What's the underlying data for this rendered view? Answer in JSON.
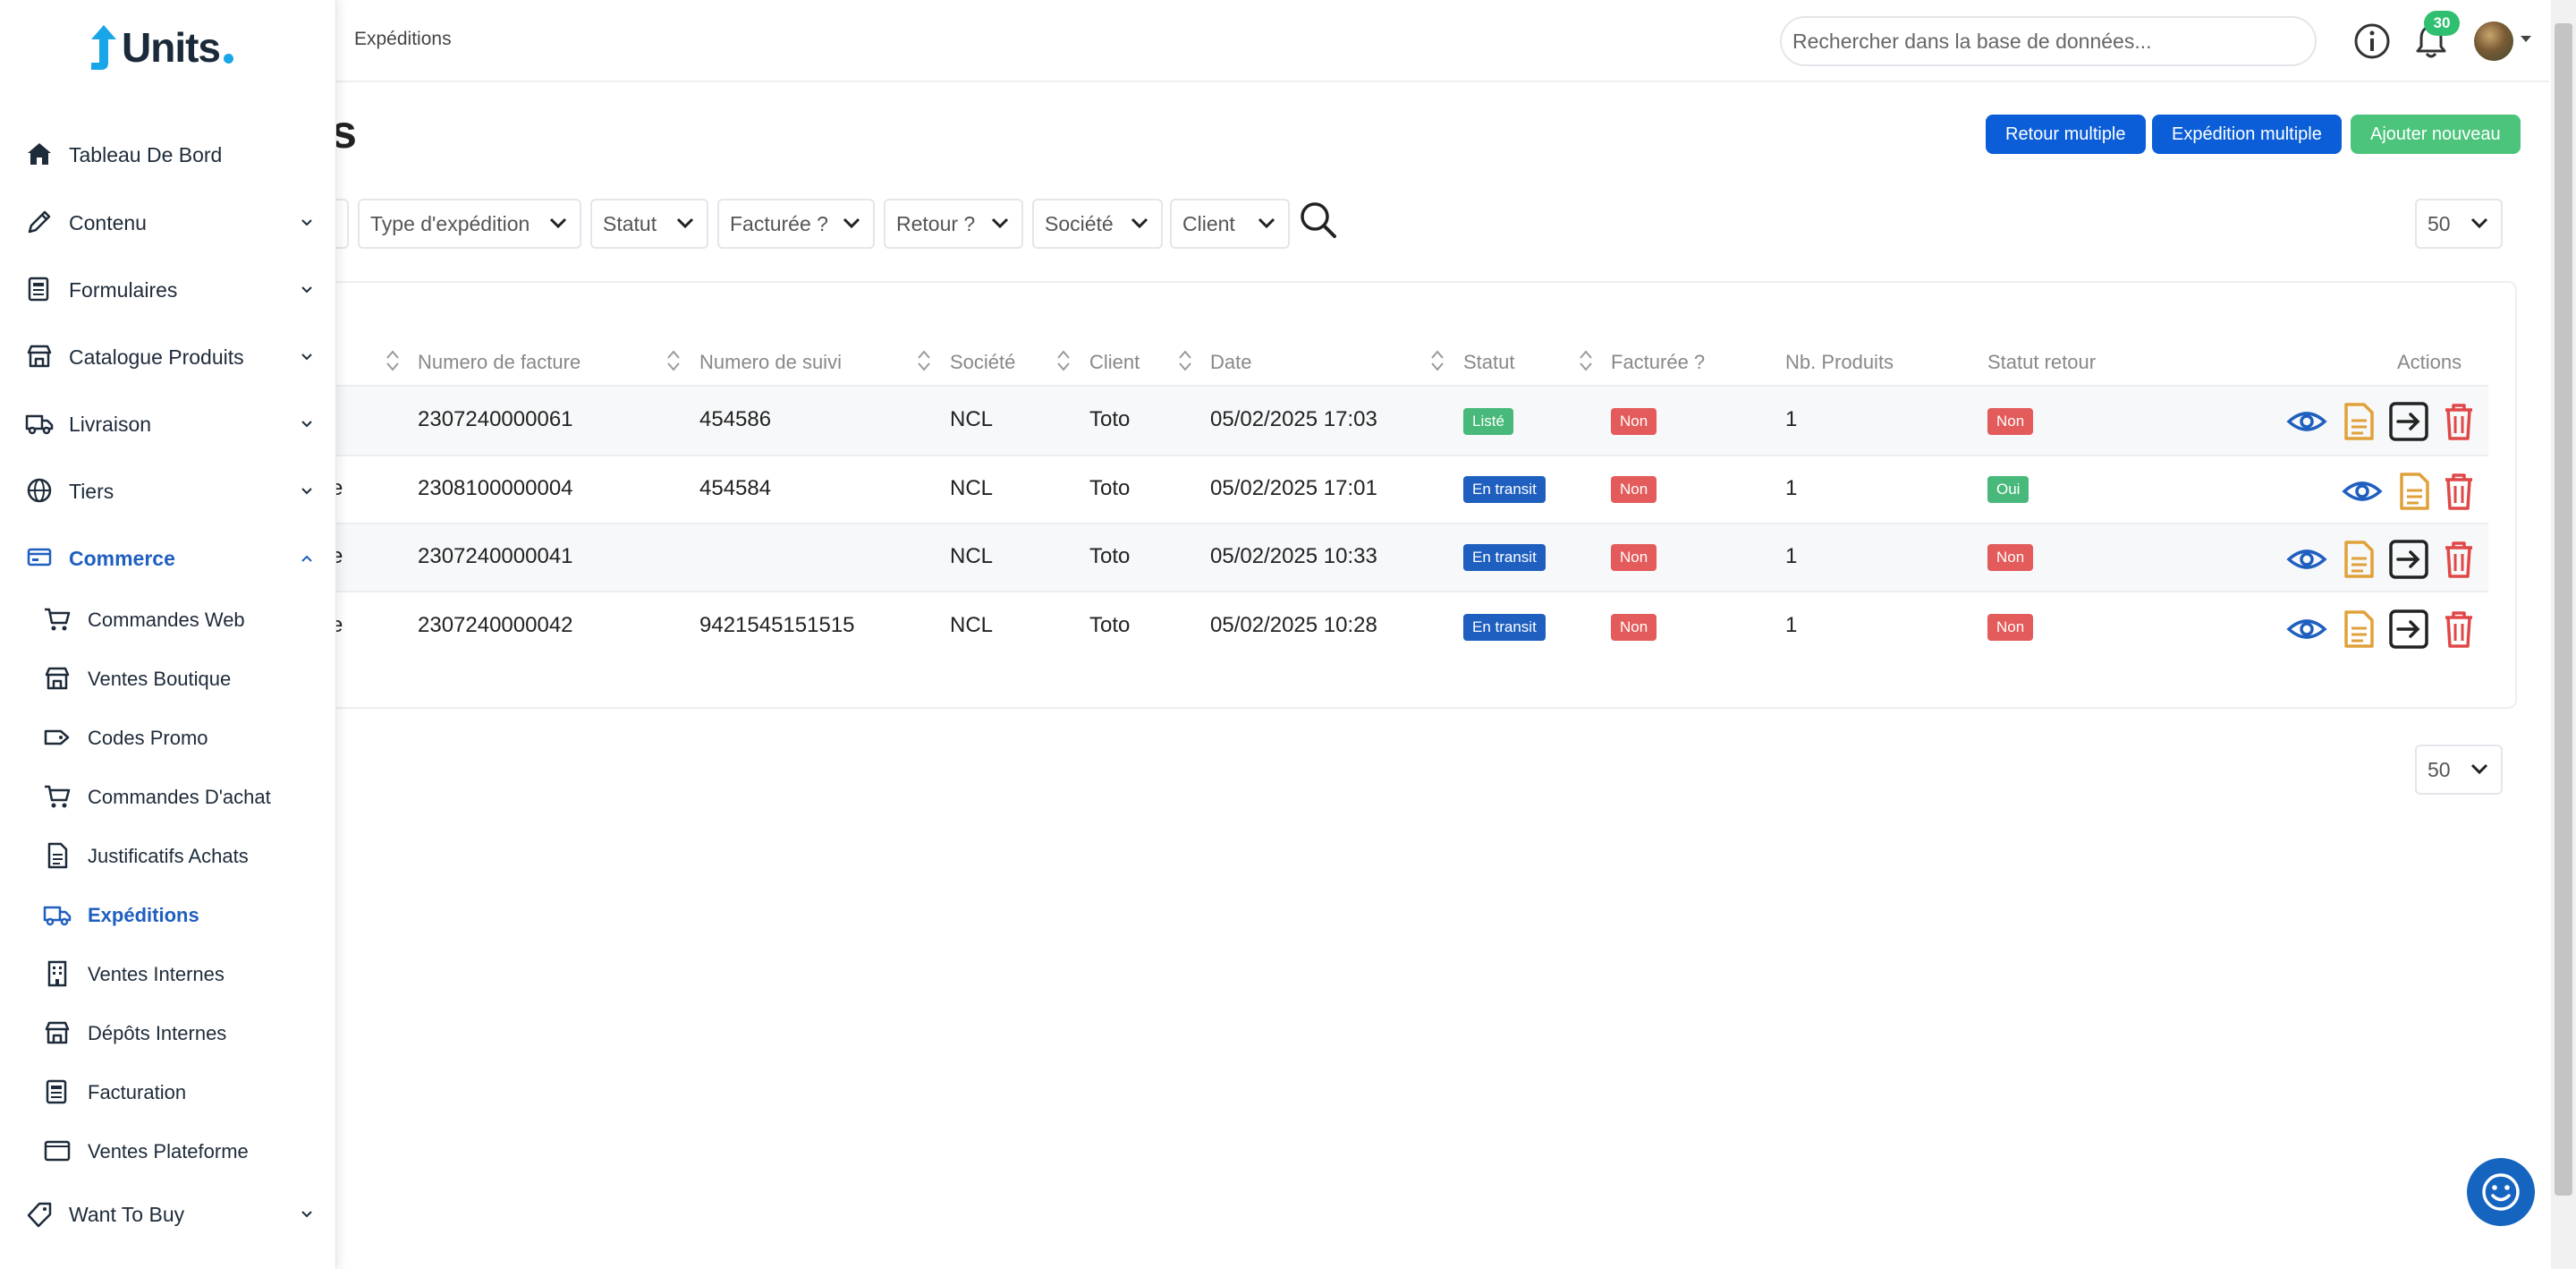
{
  "breadcrumb": {
    "current": "Expéditions"
  },
  "search": {
    "placeholder": "Rechercher dans la base de données..."
  },
  "notifications": {
    "count": "30"
  },
  "page": {
    "title_fragment": "s"
  },
  "actions": {
    "retour_multiple": "Retour multiple",
    "expedition_multiple": "Expédition multiple",
    "ajouter_nouveau": "Ajouter nouveau"
  },
  "filters": {
    "type_expedition": "Type d'expédition",
    "statut": "Statut",
    "facturee": "Facturée ?",
    "retour": "Retour ?",
    "societe": "Société",
    "client": "Client",
    "per_page_top": "50",
    "per_page_bottom": "50"
  },
  "table": {
    "headers": {
      "numero_facture": "Numero de facture",
      "numero_suivi": "Numero de suivi",
      "societe": "Société",
      "client": "Client",
      "date": "Date",
      "statut": "Statut",
      "facturee": "Facturée ?",
      "nb_produits": "Nb. Produits",
      "statut_retour": "Statut retour",
      "actions": "Actions"
    },
    "rows": [
      {
        "prefix": "",
        "facture": "2307240000061",
        "suivi": "454586",
        "societe": "NCL",
        "client": "Toto",
        "date": "05/02/2025 17:03",
        "statut": "Listé",
        "facturee": "Non",
        "nb": "1",
        "retour": "Non"
      },
      {
        "prefix": "e",
        "facture": "2308100000004",
        "suivi": "454584",
        "societe": "NCL",
        "client": "Toto",
        "date": "05/02/2025 17:01",
        "statut": "En transit",
        "facturee": "Non",
        "nb": "1",
        "retour": "Oui"
      },
      {
        "prefix": "e",
        "facture": "2307240000041",
        "suivi": "",
        "societe": "NCL",
        "client": "Toto",
        "date": "05/02/2025 10:33",
        "statut": "En transit",
        "facturee": "Non",
        "nb": "1",
        "retour": "Non"
      },
      {
        "prefix": "e",
        "facture": "2307240000042",
        "suivi": "9421545151515",
        "societe": "NCL",
        "client": "Toto",
        "date": "05/02/2025 10:28",
        "statut": "En transit",
        "facturee": "Non",
        "nb": "1",
        "retour": "Non"
      }
    ]
  },
  "sidebar": {
    "logo": "Units",
    "items": [
      {
        "label": "Tableau De Bord",
        "icon": "home-icon"
      },
      {
        "label": "Contenu",
        "icon": "pencil-icon"
      },
      {
        "label": "Formulaires",
        "icon": "form-icon"
      },
      {
        "label": "Catalogue Produits",
        "icon": "store-icon"
      },
      {
        "label": "Livraison",
        "icon": "truck-icon"
      },
      {
        "label": "Tiers",
        "icon": "globe-icon"
      },
      {
        "label": "Commerce",
        "icon": "card-icon"
      },
      {
        "label": "Want To Buy",
        "icon": "tag-icon"
      }
    ],
    "commerce_sub": [
      {
        "label": "Commandes Web",
        "icon": "cart-icon"
      },
      {
        "label": "Ventes Boutique",
        "icon": "shop-icon"
      },
      {
        "label": "Codes Promo",
        "icon": "tag-icon"
      },
      {
        "label": "Commandes D'achat",
        "icon": "cart-icon"
      },
      {
        "label": "Justificatifs Achats",
        "icon": "document-icon"
      },
      {
        "label": "Expéditions",
        "icon": "truck-icon"
      },
      {
        "label": "Ventes Internes",
        "icon": "building-icon"
      },
      {
        "label": "Dépôts Internes",
        "icon": "shop-icon"
      },
      {
        "label": "Facturation",
        "icon": "invoice-icon"
      },
      {
        "label": "Ventes Plateforme",
        "icon": "window-icon"
      }
    ]
  },
  "colors": {
    "primary": "#0b5ed7",
    "success": "#4cc47b",
    "danger": "#e35b5b",
    "active_nav": "#1f5fbf"
  }
}
